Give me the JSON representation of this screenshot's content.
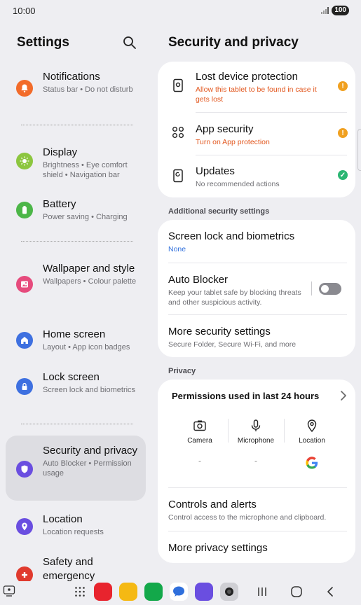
{
  "status_bar": {
    "time": "10:00",
    "battery": "100"
  },
  "settings": {
    "title": "Settings",
    "items": [
      {
        "label": "Notifications",
        "sub": "Status bar • Do not disturb",
        "icon": "bell-icon",
        "color": "#f26b2a"
      },
      {
        "label": "Display",
        "sub": "Brightness • Eye comfort shield • Navigation bar",
        "icon": "sun-icon",
        "color": "#8cc63f"
      },
      {
        "label": "Battery",
        "sub": "Power saving • Charging",
        "icon": "battery-icon",
        "color": "#4cb648"
      },
      {
        "label": "Wallpaper and style",
        "sub": "Wallpapers • Colour palette",
        "icon": "image-icon",
        "color": "#e64b7d"
      },
      {
        "label": "Home screen",
        "sub": "Layout • App icon badges",
        "icon": "home-icon",
        "color": "#3e70e0"
      },
      {
        "label": "Lock screen",
        "sub": "Screen lock and biometrics",
        "icon": "lock-icon",
        "color": "#3e70e0"
      },
      {
        "label": "Security and privacy",
        "sub": "Auto Blocker • Permission usage",
        "icon": "shield-icon",
        "color": "#6a4ee0"
      },
      {
        "label": "Location",
        "sub": "Location requests",
        "icon": "location-pin-icon",
        "color": "#6a4ee0"
      },
      {
        "label": "Safety and emergency",
        "sub": "",
        "icon": "emergency-icon",
        "color": "#e03a2e"
      }
    ]
  },
  "security": {
    "title": "Security and privacy",
    "top_card": [
      {
        "label": "Lost device protection",
        "sub": "Allow this tablet to be found in case it gets lost",
        "status": "warning"
      },
      {
        "label": "App security",
        "sub": "Turn on App protection",
        "status": "warning"
      },
      {
        "label": "Updates",
        "sub": "No recommended actions",
        "status": "ok"
      }
    ],
    "additional_header": "Additional security settings",
    "screen_lock": {
      "label": "Screen lock and biometrics",
      "sub": "None"
    },
    "auto_blocker": {
      "label": "Auto Blocker",
      "sub": "Keep your tablet safe by blocking threats and other suspicious activity.",
      "enabled": false
    },
    "more_security": {
      "label": "More security settings",
      "sub": "Secure Folder, Secure Wi-Fi, and more"
    },
    "privacy_header": "Privacy",
    "permissions": {
      "title": "Permissions used in last 24 hours",
      "columns": [
        {
          "name": "Camera",
          "value": "-"
        },
        {
          "name": "Microphone",
          "value": "-"
        },
        {
          "name": "Location",
          "value": ""
        }
      ]
    },
    "controls": {
      "label": "Controls and alerts",
      "sub": "Control access to the microphone and clipboard."
    },
    "more_privacy": {
      "label": "More privacy settings"
    }
  },
  "colors": {
    "warning": "#f0a020",
    "ok": "#2bb673",
    "accent_blue": "#2f6fdc",
    "warning_text": "#e2571e"
  }
}
